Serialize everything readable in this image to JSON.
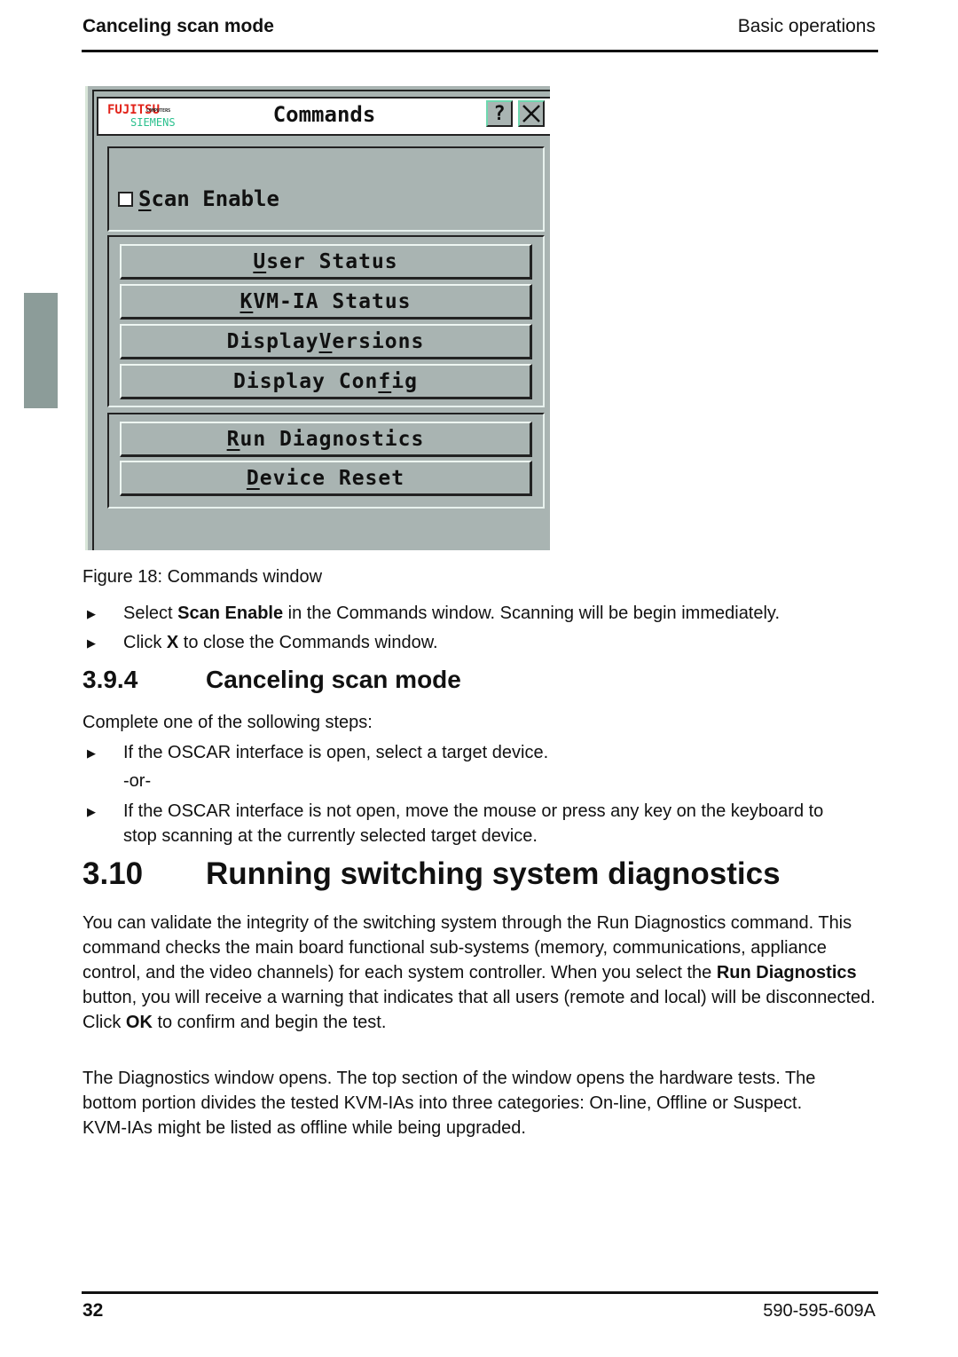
{
  "header": {
    "section_title": "Canceling scan mode",
    "chapter_title": "Basic operations"
  },
  "window": {
    "logo_top": "FUJITSU",
    "logo_sub": "COMPUTERS",
    "logo_bottom": "SIEMENS",
    "title": "Commands",
    "help_button": "?",
    "close_button": "X",
    "scan_enable": {
      "before": "",
      "accel": "S",
      "after": "can Enable",
      "checked": false
    },
    "group_status": [
      {
        "before": "",
        "accel": "U",
        "after": "ser Status"
      },
      {
        "before": "",
        "accel": "K",
        "after": "VM-IA Status"
      },
      {
        "before": "Display ",
        "accel": "V",
        "after": "ersions"
      },
      {
        "before": "Display Con",
        "accel": "f",
        "after": "ig"
      }
    ],
    "group_actions": [
      {
        "before": "",
        "accel": "R",
        "after": "un Diagnostics"
      },
      {
        "before": "",
        "accel": "D",
        "after": "evice Reset"
      }
    ]
  },
  "figure_caption": "Figure 18: Commands window",
  "steps1": [
    {
      "pre": "Select ",
      "bold": "Scan Enable",
      "post": " in the Commands window. Scanning will be begin immediately."
    },
    {
      "pre": "Click ",
      "bold": "X",
      "post": " to close the Commands window."
    }
  ],
  "section_394": {
    "number": "3.9.4",
    "title": "Canceling scan mode",
    "intro": "Complete one of the sollowing steps:",
    "step1": "If the OSCAR interface is open, select a target device.",
    "or": "-or-",
    "step2": "If the OSCAR interface is not open, move the mouse or press any key on the keyboard to stop scanning at the currently selected target device."
  },
  "section_310": {
    "number": "3.10",
    "title": "Running switching system diagnostics",
    "p1_a": "You can validate the integrity of the switching system through the Run Diagnostics command. This command checks the main board functional sub-systems (memory, communications, appliance control, and the video channels) for each system controller. When you select the ",
    "p1_b": "Run Diagnostics",
    "p1_c": " button, you will receive a warning that indicates that all users (remote and local) will be disconnected. Click ",
    "p1_d": "OK",
    "p1_e": " to confirm and begin the test.",
    "p2": "The Diagnostics window opens. The top section of the window opens the hardware tests. The bottom portion divides the tested KVM-IAs into three categories: On-line, Offline or Suspect. KVM-IAs might be listed as offline while being upgraded."
  },
  "footer": {
    "page_number": "32",
    "doc_number": "590-595-609A"
  },
  "icons": {
    "bullet": "▶"
  }
}
